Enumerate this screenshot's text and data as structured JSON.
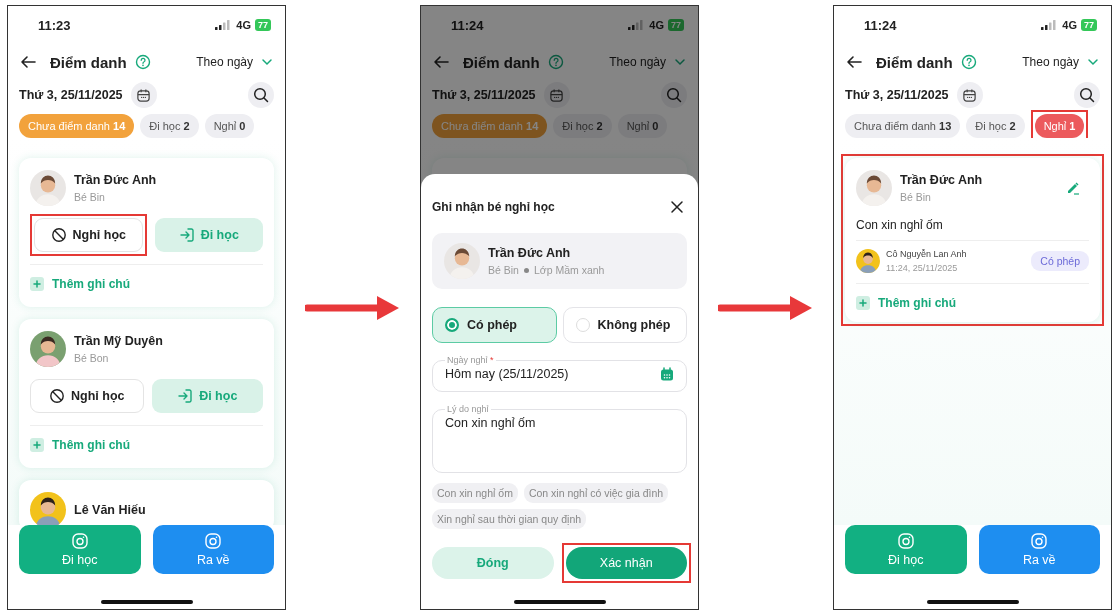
{
  "screens": [
    {
      "kind": "attendance_list",
      "status_bar": {
        "time": "11:23",
        "network": "4G",
        "battery": "77"
      },
      "header": {
        "title": "Điểm danh",
        "view_mode": "Theo ngày"
      },
      "date": "Thứ 3, 25/11/2025",
      "tabs": [
        {
          "label": "Chưa điểm danh",
          "count": "14",
          "selected": true,
          "color": "#f2a23c",
          "highlighted": false
        },
        {
          "label": "Đi học",
          "count": "2",
          "selected": false,
          "highlighted": false
        },
        {
          "label": "Nghỉ",
          "count": "0",
          "selected": false,
          "highlighted": false
        }
      ],
      "students": [
        {
          "name": "Trần Đức Anh",
          "nickname": "Bé Bin",
          "absent_button": "Nghỉ học",
          "present_button": "Đi học",
          "add_note": "Thêm ghi chú",
          "absent_highlighted": true
        },
        {
          "name": "Trần Mỹ Duyên",
          "nickname": "Bé Bon",
          "absent_button": "Nghỉ học",
          "present_button": "Đi học",
          "add_note": "Thêm ghi chú",
          "absent_highlighted": false
        },
        {
          "name": "Lê Văn Hiếu"
        }
      ],
      "bottom_buttons": [
        {
          "kind": "check_in",
          "label": "Đi học"
        },
        {
          "kind": "check_out",
          "label": "Ra về"
        }
      ]
    },
    {
      "kind": "absence_dialog",
      "status_bar": {
        "time": "11:24",
        "network": "4G",
        "battery": "77"
      },
      "header": {
        "title": "Điểm danh",
        "view_mode": "Theo ngày"
      },
      "date": "Thứ 3, 25/11/2025",
      "tabs": [
        {
          "label": "Chưa điểm danh",
          "count": "14",
          "selected": true,
          "highlighted": false
        },
        {
          "label": "Đi học",
          "count": "2",
          "selected": false,
          "highlighted": false
        },
        {
          "label": "Nghỉ",
          "count": "0",
          "selected": false,
          "highlighted": false
        }
      ],
      "dialog": {
        "title": "Ghi nhận bé nghỉ học",
        "student": {
          "name": "Trần Đức Anh",
          "nickname": "Bé Bin",
          "class": "Lớp Mầm xanh"
        },
        "options": [
          {
            "label": "Có phép",
            "selected": true
          },
          {
            "label": "Không phép",
            "selected": false
          }
        ],
        "date_field": {
          "label": "Ngày nghỉ",
          "required_mark": "*",
          "value": "Hôm nay (25/11/2025)"
        },
        "reason_field": {
          "label": "Lý do nghỉ",
          "value": "Con xin nghỉ ốm"
        },
        "suggestions": [
          "Con xin nghỉ ốm",
          "Con xin nghỉ có việc gia đình",
          "Xin nghỉ sau thời gian quy định"
        ],
        "buttons": [
          {
            "kind": "secondary",
            "label": "Đóng",
            "highlighted": false
          },
          {
            "kind": "primary",
            "label": "Xác nhận",
            "highlighted": true
          }
        ]
      }
    },
    {
      "kind": "absence_list",
      "status_bar": {
        "time": "11:24",
        "network": "4G",
        "battery": "77"
      },
      "header": {
        "title": "Điểm danh",
        "view_mode": "Theo ngày"
      },
      "date": "Thứ 3, 25/11/2025",
      "tabs": [
        {
          "label": "Chưa điểm danh",
          "count": "13",
          "selected": false,
          "highlighted": false
        },
        {
          "label": "Đi học",
          "count": "2",
          "selected": false,
          "highlighted": false
        },
        {
          "label": "Nghỉ",
          "count": "1",
          "selected": true,
          "color": "#ec5a5d",
          "highlighted": true
        }
      ],
      "records": [
        {
          "name": "Trần Đức Anh",
          "nickname": "Bé Bin",
          "reason": "Con xin nghỉ ốm",
          "teacher": "Cô Nguyễn Lan Anh",
          "time": "11:24, 25/11/2025",
          "permission": "Có phép",
          "add_note": "Thêm ghi chú",
          "highlighted": true
        }
      ],
      "bottom_buttons": [
        {
          "kind": "check_in",
          "label": "Đi học"
        },
        {
          "kind": "check_out",
          "label": "Ra về"
        }
      ]
    }
  ]
}
